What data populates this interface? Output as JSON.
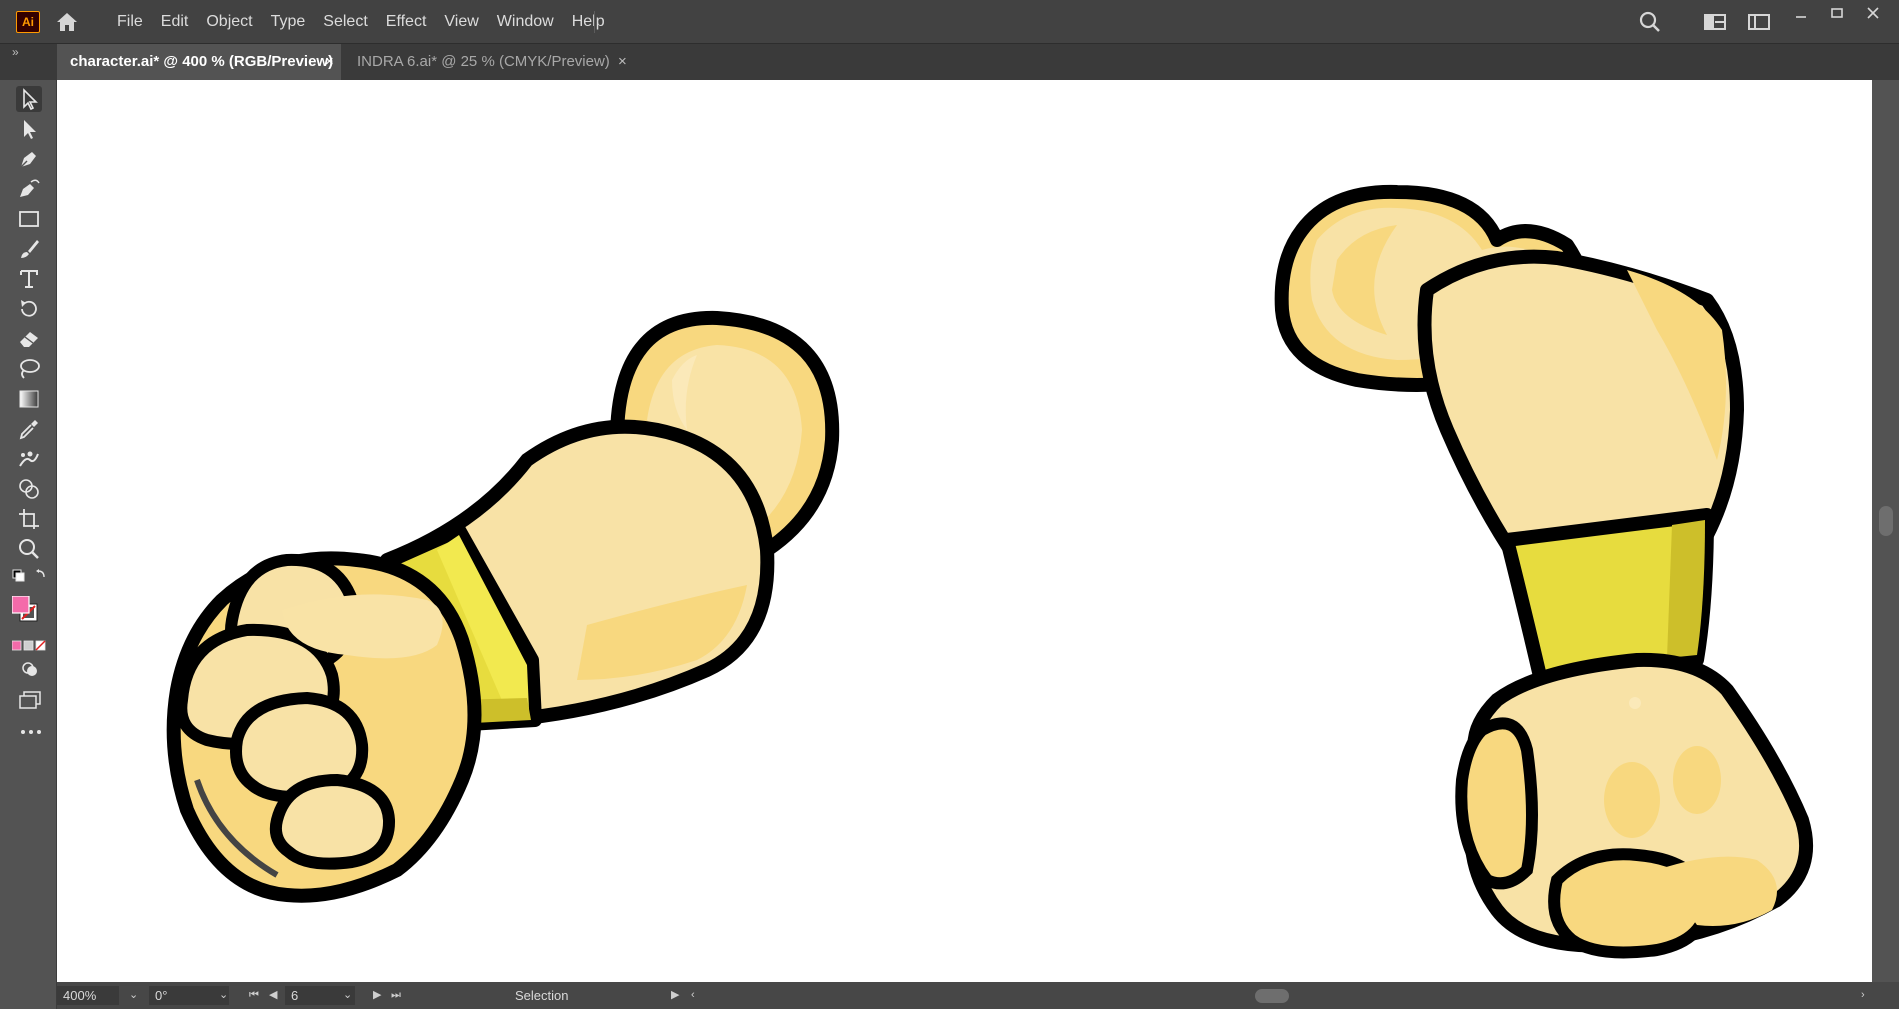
{
  "app": {
    "logo": "Ai",
    "menu": [
      "File",
      "Edit",
      "Object",
      "Type",
      "Select",
      "Effect",
      "View",
      "Window",
      "Help"
    ]
  },
  "window_controls": [
    "minimize-icon",
    "restore-icon",
    "close-icon"
  ],
  "tabs": [
    {
      "label": "character.ai* @ 400 % (RGB/Preview)",
      "active": true
    },
    {
      "label": "INDRA 6.ai* @ 25 % (CMYK/Preview)",
      "active": false
    }
  ],
  "tabs_close_glyph": "×",
  "tools": [
    "selection-tool-icon",
    "direct-selection-tool-icon",
    "pen-tool-icon",
    "curvature-tool-icon",
    "rectangle-tool-icon",
    "paintbrush-tool-icon",
    "type-tool-icon",
    "rotate-tool-icon",
    "eraser-tool-icon",
    "lasso-tool-icon",
    "gradient-tool-icon",
    "eyedropper-tool-icon",
    "puppet-warp-tool-icon",
    "shape-builder-tool-icon",
    "artboard-tool-icon",
    "zoom-tool-icon"
  ],
  "colors": {
    "fill": "#f46aaa",
    "stroke": "none",
    "outline": "#000000",
    "skin": "#f7e2a4",
    "skin_shadow": "#f8d87f",
    "wristband": "#e7dc3e",
    "wristband_shade": "#cdbf2a"
  },
  "status": {
    "zoom": "400%",
    "rotation": "0°",
    "artboard": "6",
    "tool_name": "Selection"
  }
}
